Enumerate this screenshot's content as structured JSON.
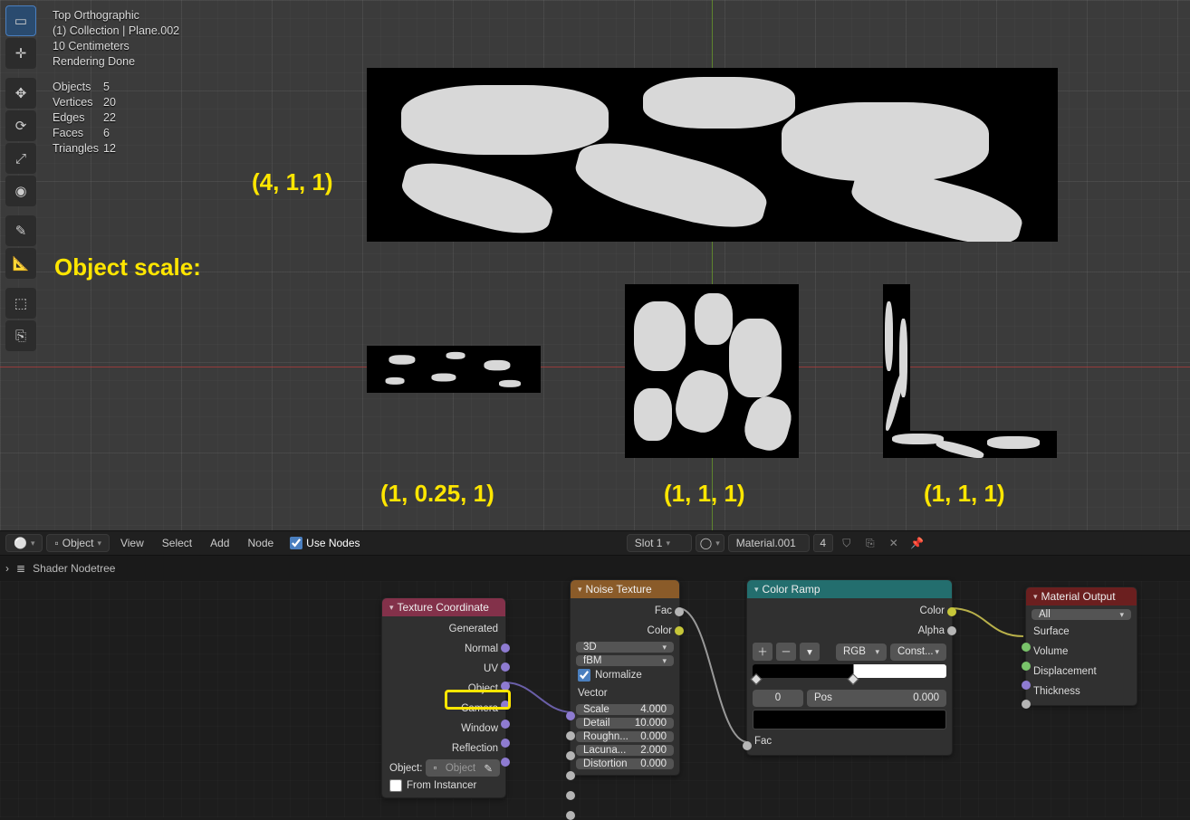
{
  "viewport": {
    "overlay": {
      "view_name": "Top Orthographic",
      "context_line": "(1) Collection | Plane.002",
      "grid_scale": "10 Centimeters",
      "render_status": "Rendering Done"
    },
    "stats": {
      "objects_label": "Objects",
      "objects": "5",
      "vertices_label": "Vertices",
      "vertices": "20",
      "edges_label": "Edges",
      "edges": "22",
      "faces_label": "Faces",
      "faces": "6",
      "triangles_label": "Triangles",
      "triangles": "12"
    },
    "toolbar_icons": [
      "select-box-icon",
      "cursor-icon",
      "move-icon",
      "rotate-icon",
      "scale-icon",
      "transform-icon",
      "annotate-icon",
      "measure-icon",
      "add-cube-icon",
      "link-icon"
    ],
    "annotations": {
      "main_label": "Object scale:",
      "plane1": "(4, 1, 1)",
      "plane2": "(1, 0.25, 1)",
      "plane3": "(1, 1, 1)",
      "plane4": "(1, 1, 1)"
    }
  },
  "node_editor_header": {
    "editor_icon": "node-editor-icon",
    "mode": "Object",
    "menus": [
      "View",
      "Select",
      "Add",
      "Node"
    ],
    "use_nodes_label": "Use Nodes",
    "use_nodes_checked": true,
    "material_slot": "Slot 1",
    "material_name": "Material.001",
    "users": "4",
    "pin": true
  },
  "breadcrumb": {
    "root_icon": "world-icon",
    "item": "Shader Nodetree"
  },
  "nodes": {
    "tex_coord": {
      "title": "Texture Coordinate",
      "outputs": [
        "Generated",
        "Normal",
        "UV",
        "Object",
        "Camera",
        "Window",
        "Reflection"
      ],
      "object_label": "Object:",
      "object_field": "Object",
      "from_instancer": "From Instancer",
      "from_instancer_checked": false,
      "highlighted_output": "Object"
    },
    "noise": {
      "title": "Noise Texture",
      "out_fac": "Fac",
      "out_color": "Color",
      "dimensions": "3D",
      "noise_type": "fBM",
      "normalize_label": "Normalize",
      "normalize_checked": true,
      "in_vector": "Vector",
      "scale_label": "Scale",
      "scale_value": "4.000",
      "detail_label": "Detail",
      "detail_value": "10.000",
      "roughness_label": "Roughn...",
      "roughness_value": "0.000",
      "lacunarity_label": "Lacuna...",
      "lacunarity_value": "2.000",
      "distortion_label": "Distortion",
      "distortion_value": "0.000"
    },
    "ramp": {
      "title": "Color Ramp",
      "out_color": "Color",
      "out_alpha": "Alpha",
      "mode_rgb": "RGB",
      "mode_interp": "Const...",
      "stop_index": "0",
      "pos_label": "Pos",
      "pos_value": "0.000",
      "in_fac": "Fac"
    },
    "output": {
      "title": "Material Output",
      "target": "All",
      "in_surface": "Surface",
      "in_volume": "Volume",
      "in_displacement": "Displacement",
      "in_thickness": "Thickness"
    }
  }
}
